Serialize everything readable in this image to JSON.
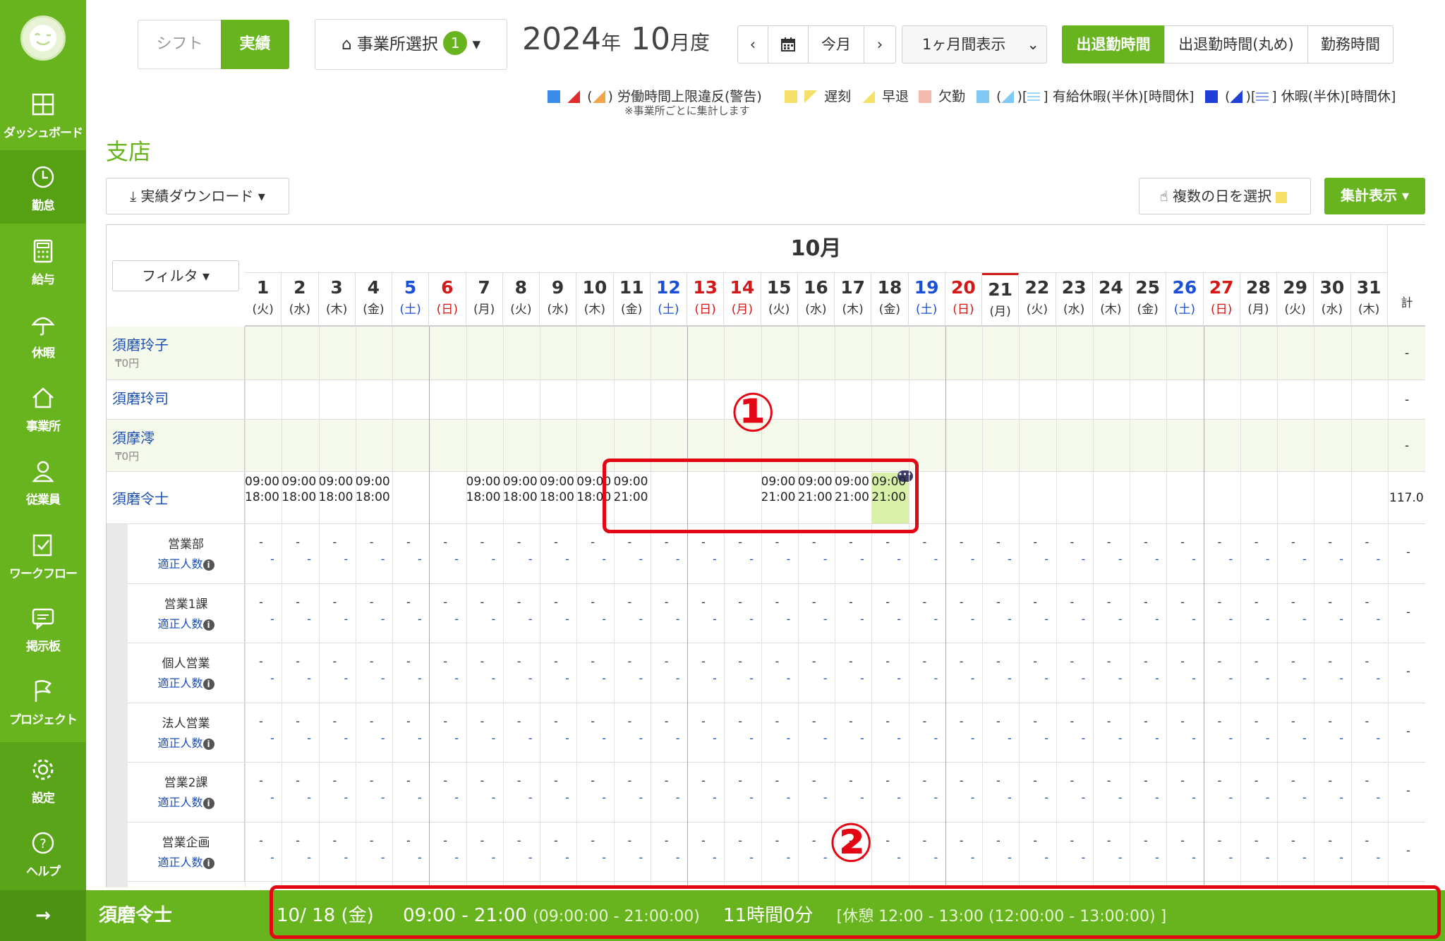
{
  "sidebar": {
    "items": [
      {
        "label": "ダッシュボード",
        "icon": "dashboard-icon"
      },
      {
        "label": "勤怠",
        "icon": "clock-icon"
      },
      {
        "label": "給与",
        "icon": "calculator-icon"
      },
      {
        "label": "休暇",
        "icon": "umbrella-icon"
      },
      {
        "label": "事業所",
        "icon": "home-icon"
      },
      {
        "label": "従業員",
        "icon": "person-icon"
      },
      {
        "label": "ワークフロー",
        "icon": "checklist-icon"
      },
      {
        "label": "掲示板",
        "icon": "message-icon"
      },
      {
        "label": "プロジェクト",
        "icon": "flag-icon"
      },
      {
        "label": "設定",
        "icon": "gear-icon"
      },
      {
        "label": "ヘルプ",
        "icon": "help-icon"
      }
    ],
    "collapse_arrow": "→"
  },
  "header": {
    "seg_shift": "シフト",
    "seg_jisseki": "実績",
    "office_select": "事業所選択",
    "office_count": "1",
    "year": "2024",
    "year_suffix": "年",
    "month": "10",
    "month_suffix": "月度",
    "prev": "‹",
    "next": "›",
    "today": "今月",
    "mode": "1ヶ月間表示",
    "toggles": [
      "出退勤時間",
      "出退勤時間(丸め)",
      "勤務時間"
    ]
  },
  "legend": {
    "labor_limit": "労働時間上限違反(警告)",
    "labor_note": "※事業所ごとに集計します",
    "late": "遅刻",
    "early": "早退",
    "absent": "欠勤",
    "paid_leave": "有給休暇(半休)[時間休]",
    "leave": "休暇(半休)[時間休]",
    "colors": {
      "late": "#f5e16a",
      "absent": "#f4b9ad",
      "paid": "#7fc9f4",
      "leave": "#1f3fd6"
    }
  },
  "branch": "支店",
  "buttons": {
    "download": "実績ダウンロード",
    "multi": "複数の日を選択",
    "summary": "集計表示",
    "filter": "フィルタ"
  },
  "grid": {
    "month_title": "10月",
    "total_label": "計",
    "days": [
      {
        "d": "1",
        "w": "(火)"
      },
      {
        "d": "2",
        "w": "(水)"
      },
      {
        "d": "3",
        "w": "(木)"
      },
      {
        "d": "4",
        "w": "(金)"
      },
      {
        "d": "5",
        "w": "(土)"
      },
      {
        "d": "6",
        "w": "(日)"
      },
      {
        "d": "7",
        "w": "(月)"
      },
      {
        "d": "8",
        "w": "(火)"
      },
      {
        "d": "9",
        "w": "(水)"
      },
      {
        "d": "10",
        "w": "(木)"
      },
      {
        "d": "11",
        "w": "(金)"
      },
      {
        "d": "12",
        "w": "(土)"
      },
      {
        "d": "13",
        "w": "(日)"
      },
      {
        "d": "14",
        "w": "(月)"
      },
      {
        "d": "15",
        "w": "(火)"
      },
      {
        "d": "16",
        "w": "(水)"
      },
      {
        "d": "17",
        "w": "(木)"
      },
      {
        "d": "18",
        "w": "(金)"
      },
      {
        "d": "19",
        "w": "(土)"
      },
      {
        "d": "20",
        "w": "(日)"
      },
      {
        "d": "21",
        "w": "(月)"
      },
      {
        "d": "22",
        "w": "(火)"
      },
      {
        "d": "23",
        "w": "(水)"
      },
      {
        "d": "24",
        "w": "(木)"
      },
      {
        "d": "25",
        "w": "(金)"
      },
      {
        "d": "26",
        "w": "(土)"
      },
      {
        "d": "27",
        "w": "(日)"
      },
      {
        "d": "28",
        "w": "(月)"
      },
      {
        "d": "29",
        "w": "(火)"
      },
      {
        "d": "30",
        "w": "(水)"
      },
      {
        "d": "31",
        "w": "(木)"
      }
    ],
    "employees": [
      {
        "name": "須磨玲子",
        "yen": "₸0円",
        "total": "-"
      },
      {
        "name": "須磨玲司",
        "yen": "",
        "total": "-"
      },
      {
        "name": "須摩澪",
        "yen": "₸0円",
        "total": "-"
      },
      {
        "name": "須磨令士",
        "yen": "",
        "total": "117.0"
      }
    ],
    "shift_in": "09:00",
    "shift_out_a": "18:00",
    "shift_out_b": "21:00",
    "departments": [
      {
        "name": "営業部",
        "sub": "適正人数"
      },
      {
        "name": "営業1課",
        "sub": "適正人数"
      },
      {
        "name": "個人営業",
        "sub": "適正人数"
      },
      {
        "name": "法人営業",
        "sub": "適正人数"
      },
      {
        "name": "営業2課",
        "sub": "適正人数"
      },
      {
        "name": "営業企画",
        "sub": "適正人数"
      }
    ],
    "dash": "-"
  },
  "bottom": {
    "employee": "須磨令士",
    "date": "10/ 18 (金)",
    "time": "09:00 - 21:00",
    "time_detail": "(09:00:00 - 21:00:00)",
    "duration": "11時間0分",
    "break": "[休憩 12:00 - 13:00 (12:00:00 - 13:00:00) ]"
  },
  "callouts": {
    "one": "①",
    "two": "②"
  }
}
